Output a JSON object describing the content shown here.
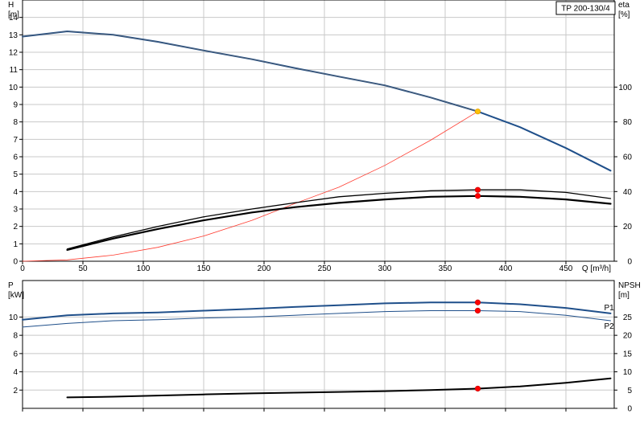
{
  "title": "TP 200-130/4",
  "chart_data": [
    {
      "type": "line",
      "title": "TP 200-130/4",
      "xlabel": "Q [m³/h]",
      "ylabel_left_top": "H",
      "ylabel_left_unit": "[m]",
      "ylabel_right_top": "eta",
      "ylabel_right_unit": "[%]",
      "xlim": [
        0,
        490
      ],
      "ylim_left": [
        0,
        15
      ],
      "ylim_right": [
        0,
        150
      ],
      "x_ticks": [
        0,
        50,
        100,
        150,
        200,
        250,
        300,
        350,
        400,
        450
      ],
      "y_ticks_left": [
        0,
        1,
        2,
        3,
        4,
        5,
        6,
        7,
        8,
        9,
        10,
        11,
        12,
        13,
        14
      ],
      "y_ticks_right": [
        0,
        20,
        40,
        60,
        80,
        100
      ],
      "grid": true,
      "series": [
        {
          "name": "",
          "axis": "left",
          "color": "#1f4f8a",
          "x": [
            0,
            37,
            75,
            112,
            150,
            190,
            225,
            262,
            300,
            338,
            377,
            412,
            450,
            487
          ],
          "y": [
            12.9,
            13.2,
            13.0,
            12.6,
            12.1,
            11.6,
            11.1,
            10.6,
            10.1,
            9.4,
            8.6,
            7.7,
            6.5,
            5.2
          ],
          "width": 2
        },
        {
          "name": "",
          "axis": "left",
          "color": "#666666",
          "x": [
            0,
            37,
            75,
            112,
            150,
            190,
            225,
            262,
            300,
            338,
            377
          ],
          "y": [
            12.9,
            13.2,
            13.0,
            12.6,
            12.1,
            11.6,
            11.1,
            10.6,
            10.1,
            9.4,
            8.6
          ],
          "width": 0.6
        },
        {
          "name": "",
          "axis": "left",
          "color": "#ff3b2f",
          "x": [
            0,
            37,
            75,
            112,
            150,
            190,
            225,
            262,
            300,
            338,
            377
          ],
          "y": [
            0,
            0.08,
            0.35,
            0.8,
            1.45,
            2.35,
            3.3,
            4.25,
            5.5,
            6.95,
            8.6
          ],
          "width": 0.8
        },
        {
          "name": "",
          "axis": "right",
          "color": "#000000",
          "x": [
            37,
            75,
            112,
            150,
            190,
            225,
            262,
            300,
            338,
            377,
            412,
            450,
            487
          ],
          "y": [
            7,
            14,
            20,
            25.5,
            30,
            33.5,
            37,
            39,
            40.5,
            41,
            41,
            39.5,
            36
          ],
          "width": 1.3
        },
        {
          "name": "",
          "axis": "right",
          "color": "#000000",
          "x": [
            37,
            75,
            112,
            150,
            190,
            225,
            262,
            300,
            338,
            377,
            412,
            450,
            487
          ],
          "y": [
            6.5,
            13,
            18.5,
            23.5,
            28,
            31,
            33.5,
            35.5,
            37,
            37.5,
            37,
            35.5,
            33
          ],
          "width": 2.2
        }
      ],
      "markers": [
        {
          "x": 377,
          "y": 8.6,
          "axis": "left",
          "color": "#ffc107",
          "stroke": "#e0a000"
        },
        {
          "x": 377,
          "y": 41,
          "axis": "right",
          "color": "#ff0000",
          "stroke": "#cc0000"
        },
        {
          "x": 377,
          "y": 37.5,
          "axis": "right",
          "color": "#ff0000",
          "stroke": "#cc0000"
        }
      ]
    },
    {
      "type": "line",
      "xlabel": "",
      "ylabel_left_top": "P",
      "ylabel_left_unit": "[kW]",
      "ylabel_right_top": "NPSH",
      "ylabel_right_unit": "[m]",
      "xlim": [
        0,
        490
      ],
      "ylim_left": [
        0,
        14
      ],
      "ylim_right": [
        0,
        35
      ],
      "x_ticks": [
        0,
        50,
        100,
        150,
        200,
        250,
        300,
        350,
        400,
        450
      ],
      "y_ticks_left": [
        2,
        4,
        6,
        8,
        10
      ],
      "y_ticks_right": [
        0,
        5,
        10,
        15,
        20,
        25
      ],
      "grid": true,
      "series": [
        {
          "name": "P1",
          "axis": "left",
          "color": "#1f4f8a",
          "x": [
            0,
            37,
            75,
            112,
            150,
            190,
            225,
            262,
            300,
            338,
            377,
            412,
            450,
            487
          ],
          "y": [
            9.7,
            10.2,
            10.4,
            10.5,
            10.7,
            10.9,
            11.1,
            11.3,
            11.5,
            11.6,
            11.6,
            11.4,
            11.0,
            10.4
          ],
          "width": 2
        },
        {
          "name": "P2",
          "axis": "left",
          "color": "#1f4f8a",
          "x": [
            0,
            37,
            75,
            112,
            150,
            190,
            225,
            262,
            300,
            338,
            377,
            412,
            450,
            487
          ],
          "y": [
            8.9,
            9.3,
            9.6,
            9.7,
            9.9,
            10.0,
            10.2,
            10.4,
            10.6,
            10.7,
            10.7,
            10.6,
            10.2,
            9.6
          ],
          "width": 1
        },
        {
          "name": "",
          "axis": "right",
          "color": "#000000",
          "x": [
            37,
            75,
            112,
            150,
            190,
            225,
            262,
            300,
            338,
            377,
            412,
            450,
            487
          ],
          "y": [
            3,
            3.2,
            3.5,
            3.8,
            4.1,
            4.3,
            4.5,
            4.7,
            5.0,
            5.4,
            6.0,
            7.0,
            8.2
          ],
          "width": 2
        }
      ],
      "markers": [
        {
          "x": 377,
          "y": 11.6,
          "axis": "left",
          "color": "#ff0000",
          "stroke": "#cc0000"
        },
        {
          "x": 377,
          "y": 10.7,
          "axis": "left",
          "color": "#ff0000",
          "stroke": "#cc0000"
        },
        {
          "x": 377,
          "y": 5.4,
          "axis": "right",
          "color": "#ff0000",
          "stroke": "#cc0000"
        }
      ]
    }
  ]
}
